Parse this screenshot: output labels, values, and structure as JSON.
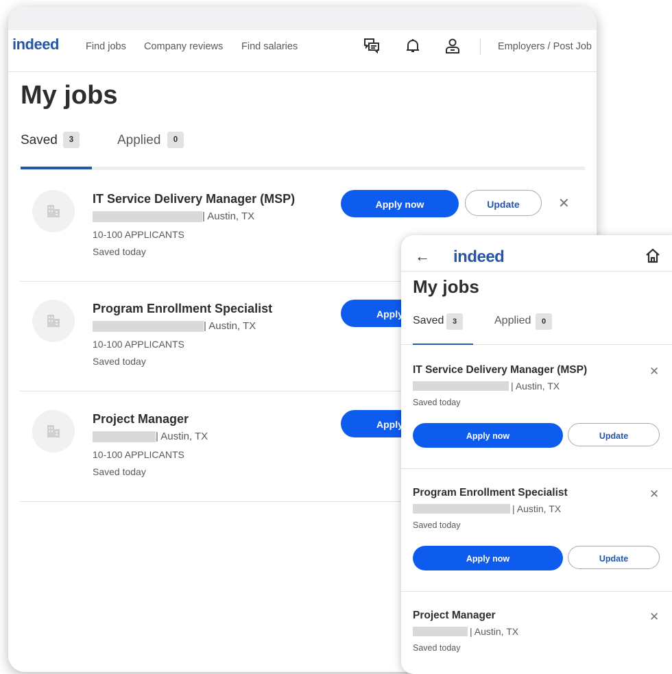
{
  "colors": {
    "brand_blue": "#2557a7",
    "apply_blue": "#0e5ced",
    "badge_gray": "#e4e2e0",
    "redaction_gray": "#d9d9d9"
  },
  "desktop": {
    "brand": "indeed",
    "nav": {
      "find_jobs": "Find jobs",
      "company_reviews": "Company reviews",
      "find_salaries": "Find salaries",
      "employers": "Employers / Post Job"
    },
    "icons": [
      "messages-icon",
      "bell-icon",
      "profile-icon"
    ],
    "page_title": "My jobs",
    "tabs": [
      {
        "label": "Saved",
        "count": "3",
        "active": true
      },
      {
        "label": "Applied",
        "count": "0",
        "active": false
      }
    ],
    "jobs": [
      {
        "title": "IT Service Delivery Manager (MSP)",
        "location": "| Austin, TX",
        "applicants": "10-100 APPLICANTS",
        "saved": "Saved today",
        "apply_label": "Apply now",
        "update_label": "Update",
        "dismiss": "✕"
      },
      {
        "title": "Program Enrollment Specialist",
        "location": "| Austin, TX",
        "applicants": "10-100 APPLICANTS",
        "saved": "Saved today",
        "apply_label": "Apply"
      },
      {
        "title": "Project Manager",
        "location": "| Austin, TX",
        "applicants": "10-100 APPLICANTS",
        "saved": "Saved today",
        "apply_label": "Apply"
      }
    ]
  },
  "mobile": {
    "brand": "indeed",
    "back": "←",
    "page_title": "My jobs",
    "tabs": [
      {
        "label": "Saved",
        "count": "3",
        "active": true
      },
      {
        "label": "Applied",
        "count": "0",
        "active": false
      }
    ],
    "jobs": [
      {
        "title": "IT Service Delivery Manager (MSP)",
        "location": "| Austin, TX",
        "saved": "Saved today",
        "apply_label": "Apply now",
        "update_label": "Update",
        "dismiss": "✕"
      },
      {
        "title": "Program Enrollment Specialist",
        "location": "| Austin, TX",
        "saved": "Saved today",
        "apply_label": "Apply now",
        "update_label": "Update",
        "dismiss": "✕"
      },
      {
        "title": "Project Manager",
        "location": "| Austin, TX",
        "saved": "Saved today",
        "dismiss": "✕"
      }
    ]
  }
}
